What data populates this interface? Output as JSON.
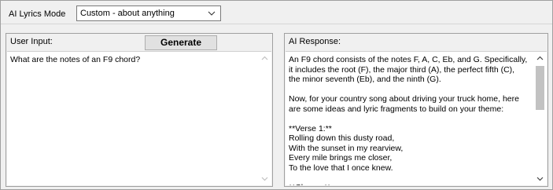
{
  "mode": {
    "label": "AI Lyrics Mode",
    "selected": "Custom - about anything"
  },
  "input_panel": {
    "title": "User Input:",
    "generate_label": "Generate",
    "text": "What are the notes of an F9 chord?"
  },
  "response_panel": {
    "title": "AI Response:",
    "text": "An F9 chord consists of the notes F, A, C, Eb, and G. Specifically,\nit includes the root (F), the major third (A), the perfect fifth (C),\nthe minor seventh (Eb), and the ninth (G).\n\nNow, for your country song about driving your truck home, here\nare some ideas and lyric fragments to build on your theme:\n\n**Verse 1:**\nRolling down this dusty road,\nWith the sunset in my rearview,\nEvery mile brings me closer,\nTo the love that I once knew.\n\n**Chorus:**"
  },
  "icons": {
    "dropdown": "chevron-down-icon",
    "scroll_up": "scroll-up-arrow-icon",
    "scroll_down": "scroll-down-arrow-icon"
  },
  "colors": {
    "window_bg": "#f0f0f0",
    "border": "#a0a0a0",
    "button_bg": "#e1e1e1",
    "scroll_thumb": "#c2c2c2"
  }
}
